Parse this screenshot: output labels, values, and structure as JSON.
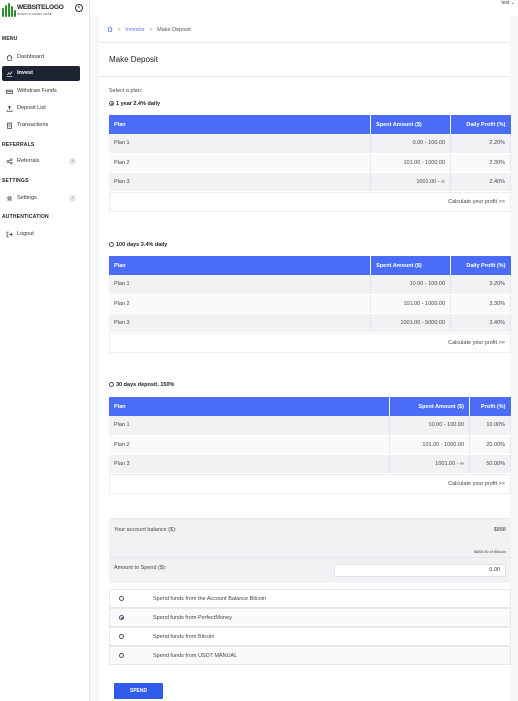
{
  "logo": {
    "title": "WEBSITELOGO",
    "tagline": "INVEST & MONEY MAKE"
  },
  "user": {
    "name": "test"
  },
  "sidebar": {
    "sections": {
      "menu": "MENU",
      "referrals": "REFERRALS",
      "settings": "SETTINGS",
      "auth": "AUTHENTICATION"
    },
    "items": [
      {
        "label": "Dashboard",
        "icon": "home-icon"
      },
      {
        "label": "Invest",
        "icon": "chart-icon",
        "active": true
      },
      {
        "label": "Withdraw Funds",
        "icon": "withdraw-icon"
      },
      {
        "label": "Deposit List",
        "icon": "upload-icon"
      },
      {
        "label": "Transactions",
        "icon": "clipboard-icon"
      },
      {
        "label": "Referrals",
        "icon": "share-icon"
      },
      {
        "label": "Settings",
        "icon": "gear-icon"
      },
      {
        "label": "Logout",
        "icon": "logout-icon"
      }
    ]
  },
  "breadcrumb": {
    "root": "Investor",
    "current": "Make Deposit"
  },
  "page": {
    "title": "Make Deposit",
    "select_label": "Select a plan:"
  },
  "plans": [
    {
      "title": "1 year 2.4% daily",
      "selected": true,
      "headers": [
        "Plan",
        "Spent Amount ($)",
        "Daily Profit (%)"
      ],
      "rows": [
        [
          "Plan 1",
          "0.00 - 100.00",
          "2.20%"
        ],
        [
          "Plan 2",
          "101.00 - 1000.00",
          "2.30%"
        ],
        [
          "Plan 3",
          "1001.00 - ∞",
          "2.40%"
        ]
      ],
      "calc": "Calculate your profit >>"
    },
    {
      "title": "100 days 3.4% daily",
      "selected": false,
      "headers": [
        "Plan",
        "Spent Amount ($)",
        "Daily Profit (%)"
      ],
      "rows": [
        [
          "Plan 1",
          "10.00 - 100.00",
          "3.20%"
        ],
        [
          "Plan 2",
          "101.00 - 1000.00",
          "3.30%"
        ],
        [
          "Plan 3",
          "1001.00 - 5000.00",
          "3.40%"
        ]
      ],
      "calc": "Calculate your profit >>"
    },
    {
      "title": "30 days deposit, 150%",
      "selected": false,
      "headers": [
        "Plan",
        "Spent Amount ($)",
        "Profit (%)"
      ],
      "rows": [
        [
          "Plan 1",
          "10.00 - 100.00",
          "10.00%"
        ],
        [
          "Plan 2",
          "101.00 - 1000.00",
          "20.00%"
        ],
        [
          "Plan 3",
          "1001.00 - ∞",
          "50.00%"
        ]
      ],
      "calc": "Calculate your profit >>"
    }
  ],
  "balance": {
    "label": "Your account balance ($):",
    "value": "$888",
    "note": "$888.00 of Bitcoin"
  },
  "spend": {
    "label": "Amount to Spend ($):",
    "value": "0.00"
  },
  "options": [
    {
      "label": "Spend funds from the Account Balance Bitcoin",
      "selected": false
    },
    {
      "label": "Spend funds from PerfectMoney",
      "selected": true
    },
    {
      "label": "Spend funds from Bitcoin",
      "selected": false
    },
    {
      "label": "Spend funds from USDT MANUAL",
      "selected": false
    }
  ],
  "submit": {
    "label": "SPEND"
  },
  "colors": {
    "accent": "#4a6cf7",
    "button": "#2f5bea",
    "sidebar_active": "#1c2434",
    "logo_green": "#2e8b2e"
  }
}
